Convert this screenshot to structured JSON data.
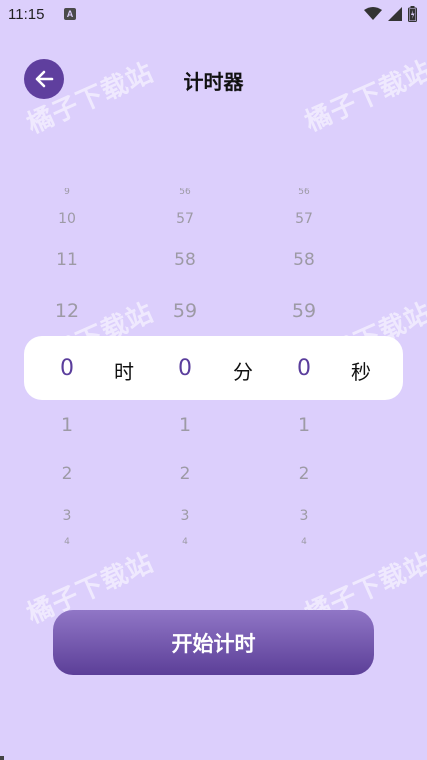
{
  "status_bar": {
    "time": "11:15",
    "notification_icon": "A",
    "icons": [
      "wifi-icon",
      "signal-icon",
      "battery-icon"
    ]
  },
  "header": {
    "title": "计时器",
    "back_icon": "arrow-left-icon"
  },
  "picker": {
    "hours": {
      "above": [
        "9",
        "10",
        "11",
        "12"
      ],
      "selected": "0",
      "unit": "时",
      "below": [
        "1",
        "2",
        "3",
        "4"
      ]
    },
    "minutes": {
      "above": [
        "56",
        "57",
        "58",
        "59"
      ],
      "selected": "0",
      "unit": "分",
      "below": [
        "1",
        "2",
        "3",
        "4"
      ]
    },
    "seconds": {
      "above": [
        "56",
        "57",
        "58",
        "59"
      ],
      "selected": "0",
      "unit": "秒",
      "below": [
        "1",
        "2",
        "3",
        "4"
      ]
    }
  },
  "start_button": {
    "label": "开始计时"
  },
  "watermark": "橘子下载站",
  "colors": {
    "background": "#dccffc",
    "accent": "#5f3f9e",
    "selected_number": "#5a3d9c"
  }
}
